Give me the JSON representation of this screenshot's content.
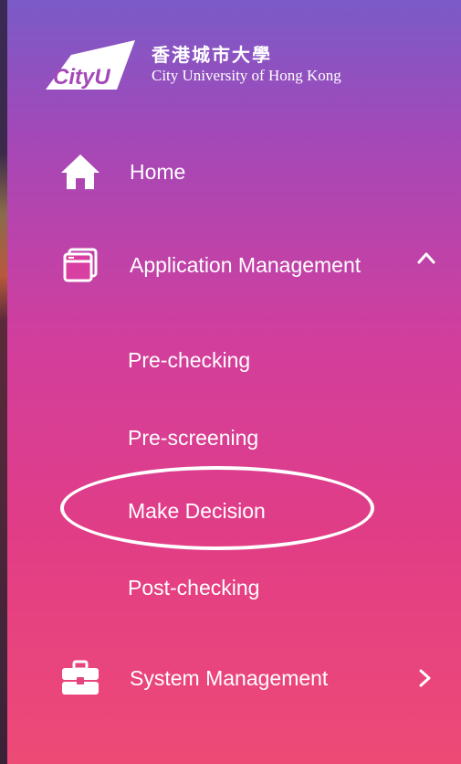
{
  "logo": {
    "mark_text": "CityU",
    "chinese_name": "香港城市大學",
    "english_name": "City University of Hong Kong"
  },
  "menu": {
    "home": {
      "label": "Home",
      "icon": "home-icon"
    },
    "application_management": {
      "label": "Application Management",
      "icon": "window-icon",
      "expanded": true,
      "sub_items": [
        {
          "label": "Pre-checking"
        },
        {
          "label": "Pre-screening"
        },
        {
          "label": "Make Decision",
          "highlighted": true
        },
        {
          "label": "Post-checking"
        }
      ]
    },
    "system_management": {
      "label": "System Management",
      "icon": "briefcase-icon",
      "expanded": false
    }
  },
  "colors": {
    "gradient_top": "#7a5bc8",
    "gradient_mid": "#d23e9c",
    "gradient_bottom": "#ee4a76",
    "text": "#ffffff"
  }
}
